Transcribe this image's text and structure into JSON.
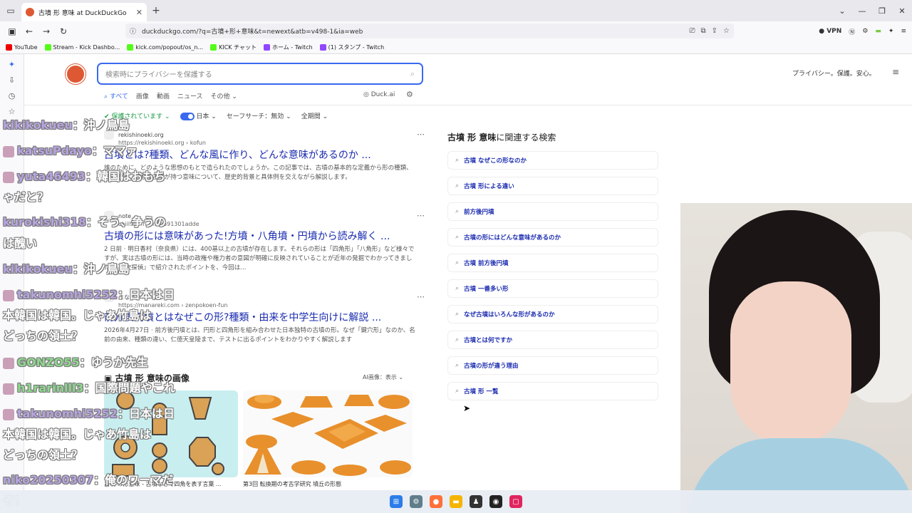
{
  "browser": {
    "tab_title": "古墳 形 意味 at DuckDuckGo",
    "url": "duckduckgo.com/?q=古墳+形+意味&t=newext&atb=v498-1&ia=web",
    "vpn_label": "VPN",
    "bookmarks": [
      "YouTube",
      "Stream - Kick Dashbo...",
      "kick.com/popout/os_n...",
      "KICK チャット",
      "ホーム - Twitch",
      "(1) スタンプ - Twitch"
    ]
  },
  "ddg": {
    "search_placeholder": "検索時にプライバシーを保護する",
    "tagline": "プライバシー。保護。安心。",
    "verticals": [
      "すべて",
      "画像",
      "動画",
      "ニュース",
      "その他"
    ],
    "duck_ai": "Duck.ai",
    "filters": {
      "protected": "保護されています",
      "region": "日本",
      "safe_search": "セーフサーチ：無効",
      "time": "全期間"
    }
  },
  "results": [
    {
      "site": "rekishinoeki.org",
      "url": "https://rekishinoeki.org › kofun",
      "title": "古墳とは?種類、どんな風に作り、どんな意味があるのか ...",
      "snippet": "誰のために、どのような思想のもとで造られたのでしょうか。この記事では、古墳の基本的な定義から形の種類、築造方法、そして古墳が持つ意味について、歴史的背景と具体例を交えながら解説します。"
    },
    {
      "site": "note",
      "url": "chiil96 › n › n6e691301adde",
      "title": "古墳の形には意味があった!方墳・八角墳・円墳から読み解く ...",
      "snippet": "2 日前 · 明日香村（奈良県）には、400基以上の古墳が存在します。それらの形は「四角形」「八角形」など様々ですが、実は古墳の形には、当時の政権や権力者の意図が明確に反映されていることが近年の発掘でわかってきました。『歴史探偵』で紹介されたポイントを、今回は..."
    },
    {
      "site": "まなれき",
      "url": "https://manareki.com › zenpokoen-fun",
      "title": "前方後円墳とはなぜこの形?種類・由来を中学生向けに解説 ...",
      "snippet": "2026年4月27日 · 前方後円墳とは、円形と四角形を組み合わせた日本独特の古墳の形。なぜ「鍵穴形」なのか、名前の由来、種類の違い、仁徳天皇陵まで、テストに出るポイントをわかりやすく解説します"
    }
  ],
  "images": {
    "heading": "古墳 形 意味の画像",
    "ai_toggle": "AI画像：表示",
    "captions": [
      "古墳 の形意味 - 古墳などで四角を表す言葉 ...",
      "第3回 転換期の考古学研究 墳丘の形態"
    ]
  },
  "related": {
    "heading_bold": "古墳 形 意味",
    "heading_rest": "に関連する検索",
    "items": [
      "古墳 なぜこの形なのか",
      "古墳 形による違い",
      "前方後円墳",
      "古墳の形にはどんな意味があるのか",
      "古墳 前方後円墳",
      "古墳 一番多い形",
      "なぜ古墳はいろんな形があるのか",
      "古墳とは何ですか",
      "古墳の形が違う理由",
      "古墳 形 一覧"
    ]
  },
  "chat": [
    {
      "user": "kikikokueu",
      "text": "：沖ノ鳥島"
    },
    {
      "user": "katsuPdayo",
      "text": "：ママァ"
    },
    {
      "user": "yuta46493",
      "text": "：韓国はおもち",
      "cont": "ゃだと？"
    },
    {
      "user": "kurokishi318",
      "text": "：そう、争うの",
      "cont": "は醜い"
    },
    {
      "user": "kikikokueu",
      "text": "：沖ノ鳥島"
    },
    {
      "user": "takunomhi5252",
      "text": "：日本は日",
      "cont": "本韓国は韓国。じゃあ竹島は",
      "cont2": "どっちの領土？"
    },
    {
      "user": "GONZO55",
      "text": "：ゆうか先生"
    },
    {
      "user": "h1rarinlll3",
      "text": "：国際問題やこれ"
    },
    {
      "user": "takunomhi5252",
      "text": "：日本は日",
      "cont": "本韓国は韓国。じゃあ竹島は",
      "cont2": "どっちの領土？"
    },
    {
      "user": "niko20250307",
      "text": "：俺のワーマだ",
      "cont": "ぞ！"
    }
  ],
  "colors": {
    "accent": "#3969ef",
    "link": "#1a2bb0",
    "ddg_brand": "#de5833"
  }
}
